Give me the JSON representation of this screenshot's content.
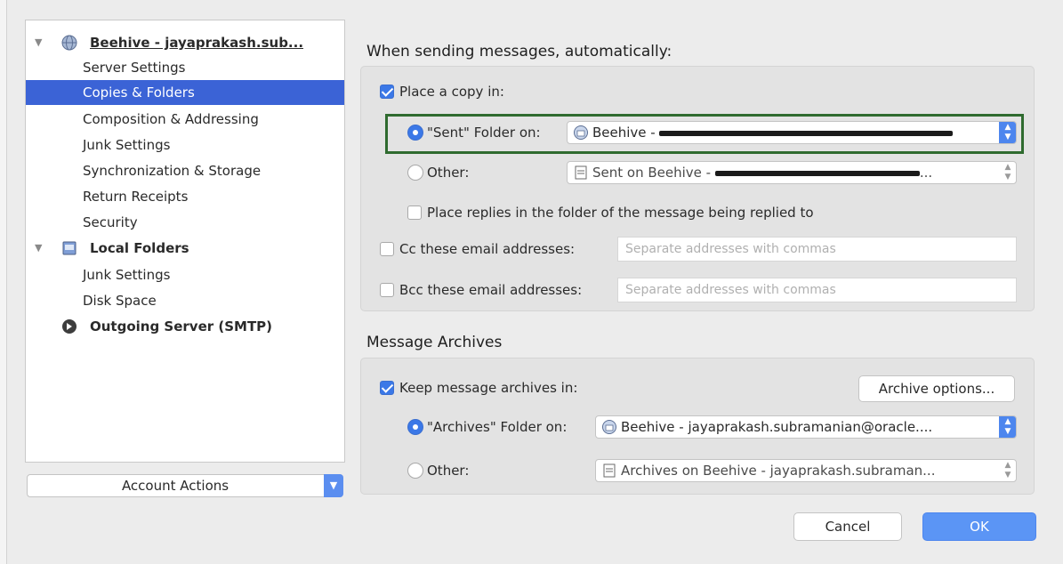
{
  "sidebar": {
    "accounts": [
      {
        "name": "Beehive - jayaprakash.sub...",
        "items": [
          "Server Settings",
          "Copies & Folders",
          "Composition & Addressing",
          "Junk Settings",
          "Synchronization & Storage",
          "Return Receipts",
          "Security"
        ],
        "selected": "Copies & Folders"
      },
      {
        "name": "Local Folders",
        "items": [
          "Junk Settings",
          "Disk Space"
        ]
      },
      {
        "name": "Outgoing Server (SMTP)",
        "items": []
      }
    ],
    "account_actions_label": "Account Actions"
  },
  "sending": {
    "heading": "When sending messages, automatically:",
    "place_copy_label": "Place a copy in:",
    "place_copy_checked": true,
    "sent_folder_label": "\"Sent\" Folder on:",
    "sent_folder_value": "Beehive - ",
    "other_label": "Other:",
    "other_value": "Sent on Beehive - ",
    "other_value_suffix": "...",
    "replies_label": "Place replies in the folder of the message being replied to",
    "cc_label": "Cc these email addresses:",
    "cc_placeholder": "Separate addresses with commas",
    "bcc_label": "Bcc these email addresses:",
    "bcc_placeholder": "Separate addresses with commas"
  },
  "archives": {
    "heading": "Message Archives",
    "keep_label": "Keep message archives in:",
    "keep_checked": true,
    "options_button": "Archive options...",
    "archives_folder_label": "\"Archives\" Folder on:",
    "archives_folder_value": "Beehive - jayaprakash.subramanian@oracle....",
    "other_label": "Other:",
    "other_value": "Archives on Beehive - jayaprakash.subraman..."
  },
  "buttons": {
    "cancel": "Cancel",
    "ok": "OK"
  },
  "colors": {
    "selection": "#3b63d6",
    "accent": "#3b78e7",
    "highlight_box": "#2f6b2f"
  }
}
